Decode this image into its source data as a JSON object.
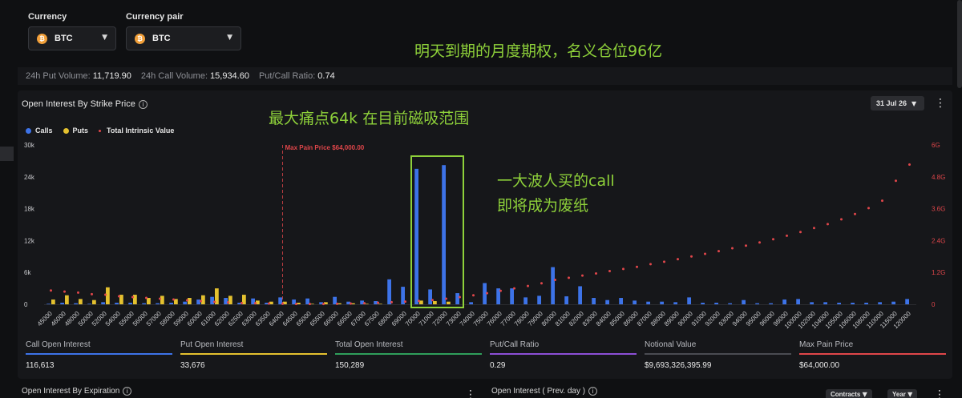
{
  "currency": {
    "label": "Currency",
    "value": "BTC",
    "icon": "bitcoin-icon"
  },
  "currency_pair": {
    "label": "Currency pair",
    "value": "BTC",
    "icon": "bitcoin-icon"
  },
  "annotations": {
    "top_note": "明天到期的月度期权，名义仓位96亿",
    "max_pain_note": "最大痛点64k 在目前磁吸范围",
    "call_note_line1": "一大波人买的call",
    "call_note_line2": "即将成为废纸"
  },
  "stats": {
    "put_volume_label": "24h Put Volume:",
    "put_volume_value": "11,719.90",
    "call_volume_label": "24h Call Volume:",
    "call_volume_value": "15,934.60",
    "ratio_label": "Put/Call Ratio:",
    "ratio_value": "0.74"
  },
  "panel": {
    "title": "Open Interest By Strike Price",
    "date": "31 Jul 26"
  },
  "legend": {
    "calls": "Calls",
    "puts": "Puts",
    "intrinsic": "Total Intrinsic Value"
  },
  "colors": {
    "calls": "#3d73e8",
    "puts": "#e4c12f",
    "intrinsic": "#e0464a",
    "accent_note": "#8ed13a"
  },
  "chart_data": {
    "type": "bar",
    "max_pain_label": "Max Pain Price $64,000.00",
    "max_pain_strike": "64000",
    "y_left_ticks": [
      "30k",
      "24k",
      "18k",
      "12k",
      "6k",
      "0"
    ],
    "y_right_ticks": [
      "6G",
      "4.8G",
      "3.6G",
      "2.4G",
      "1.2G",
      "0"
    ],
    "ylim_left": [
      0,
      30000
    ],
    "ylim_right": [
      0,
      6
    ],
    "categories": [
      "45000",
      "46000",
      "48000",
      "50000",
      "52000",
      "54000",
      "55000",
      "56000",
      "57000",
      "58000",
      "59000",
      "60000",
      "61000",
      "62000",
      "62500",
      "63000",
      "63500",
      "64000",
      "64500",
      "65000",
      "65500",
      "66000",
      "66500",
      "67000",
      "67500",
      "68000",
      "69000",
      "70000",
      "71000",
      "72000",
      "73000",
      "74000",
      "75000",
      "76000",
      "77000",
      "78000",
      "79000",
      "80000",
      "81000",
      "82000",
      "83000",
      "84000",
      "85000",
      "86000",
      "87000",
      "88000",
      "89000",
      "90000",
      "91000",
      "92000",
      "93000",
      "94000",
      "95000",
      "96000",
      "98000",
      "100000",
      "102000",
      "104000",
      "105000",
      "106000",
      "108000",
      "110000",
      "115000",
      "120000"
    ],
    "series": [
      {
        "name": "Calls",
        "values": [
          100,
          300,
          200,
          100,
          400,
          300,
          300,
          200,
          200,
          300,
          500,
          900,
          1400,
          1200,
          300,
          1100,
          300,
          1300,
          900,
          1100,
          400,
          1400,
          500,
          700,
          600,
          4700,
          3300,
          25500,
          2800,
          26200,
          2100,
          400,
          4000,
          3000,
          3000,
          1300,
          1600,
          7000,
          1500,
          3400,
          1200,
          800,
          1200,
          700,
          500,
          500,
          400,
          1300,
          300,
          300,
          200,
          800,
          200,
          200,
          900,
          1000,
          400,
          400,
          300,
          300,
          300,
          400,
          500,
          1000
        ]
      },
      {
        "name": "Puts",
        "values": [
          900,
          1700,
          1000,
          800,
          3200,
          1800,
          1800,
          1200,
          1600,
          1000,
          1200,
          1700,
          3000,
          1600,
          1800,
          700,
          500,
          500,
          300,
          100,
          400,
          200,
          200,
          100,
          100,
          0,
          0,
          700,
          600,
          500,
          0,
          0,
          0,
          0,
          0,
          0,
          0,
          0,
          0,
          0,
          0,
          0,
          0,
          0,
          0,
          0,
          0,
          0,
          0,
          0,
          0,
          0,
          0,
          0,
          0,
          0,
          0,
          0,
          0,
          0,
          0,
          0,
          0,
          0
        ]
      },
      {
        "name": "Total Intrinsic Value",
        "values": [
          0.52,
          0.48,
          0.44,
          0.38,
          0.36,
          0.3,
          0.27,
          0.24,
          0.21,
          0.18,
          0.15,
          0.12,
          0.09,
          0.07,
          0.05,
          0.04,
          0.03,
          0.02,
          0.01,
          0.01,
          0.01,
          0.02,
          0.03,
          0.04,
          0.06,
          0.08,
          0.1,
          0.13,
          0.16,
          0.21,
          0.27,
          0.34,
          0.42,
          0.51,
          0.6,
          0.69,
          0.79,
          0.92,
          1.0,
          1.08,
          1.16,
          1.25,
          1.33,
          1.41,
          1.51,
          1.6,
          1.7,
          1.8,
          1.9,
          2.0,
          2.11,
          2.21,
          2.33,
          2.45,
          2.58,
          2.72,
          2.87,
          3.02,
          3.2,
          3.4,
          3.62,
          3.9,
          4.65,
          5.26
        ]
      }
    ]
  },
  "cards": [
    {
      "title": "Call Open Interest",
      "value": "116,613",
      "color": "#3d73e8"
    },
    {
      "title": "Put Open Interest",
      "value": "33,676",
      "color": "#e4c12f"
    },
    {
      "title": "Total Open Interest",
      "value": "150,289",
      "color": "#2f9e5b"
    },
    {
      "title": "Put/Call Ratio",
      "value": "0.29",
      "color": "#8c4fd6"
    },
    {
      "title": "Notional Value",
      "value": "$9,693,326,395.99",
      "color": "#4a4c52"
    },
    {
      "title": "Max Pain Price",
      "value": "$64,000.00",
      "color": "#e0464a"
    }
  ],
  "bottom": {
    "left_title": "Open Interest By Expiration",
    "right_title": "Open Interest ( Prev. day )",
    "contracts_btn": "Contracts",
    "year_btn": "Year"
  }
}
